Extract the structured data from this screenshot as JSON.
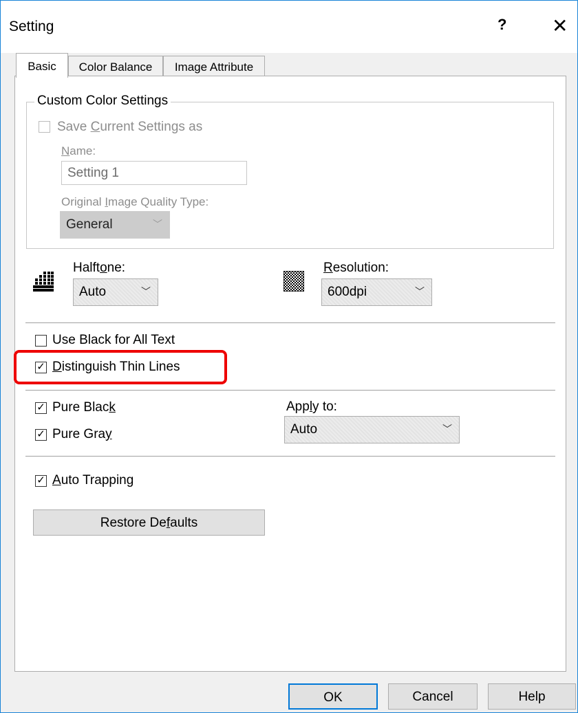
{
  "window": {
    "title": "Setting",
    "help_glyph": "?",
    "close_glyph": "✕"
  },
  "tabs": [
    {
      "label": "Basic",
      "active": true
    },
    {
      "label": "Color Balance",
      "active": false
    },
    {
      "label": "Image Attribute",
      "active": false
    }
  ],
  "custom_color": {
    "group_title": "Custom Color Settings",
    "save_checkbox": {
      "label_pre": "Save ",
      "label_u": "C",
      "label_post": "urrent Settings as",
      "checked": false,
      "enabled": false
    },
    "name_label": {
      "u": "N",
      "post": "ame:"
    },
    "name_value": "Setting 1",
    "quality_label": {
      "pre": "Original ",
      "u": "I",
      "post": "mage Quality Type:"
    },
    "quality_value": "General"
  },
  "halftone": {
    "label_pre": "Halft",
    "label_u": "o",
    "label_post": "ne:",
    "value": "Auto"
  },
  "resolution": {
    "label_u": "R",
    "label_post": "esolution:",
    "value": "600dpi"
  },
  "checkboxes": {
    "use_black_text": {
      "label": "Use Black for All Text",
      "checked": false
    },
    "distinguish_thin_lines": {
      "label_u": "D",
      "label_post": "istinguish Thin Lines",
      "checked": true
    },
    "pure_black": {
      "label_pre": "Pure Blac",
      "label_u": "k",
      "label_post": "",
      "checked": true
    },
    "pure_gray": {
      "label_pre": "Pure Gra",
      "label_u": "y",
      "label_post": "",
      "checked": true
    },
    "auto_trapping": {
      "label_u": "A",
      "label_post": "uto Trapping",
      "checked": true
    }
  },
  "apply_to": {
    "label_pre": "App",
    "label_u": "l",
    "label_post": "y to:",
    "value": "Auto"
  },
  "restore_defaults": {
    "pre": "Restore De",
    "u": "f",
    "post": "aults"
  },
  "buttons": {
    "ok": "OK",
    "cancel": "Cancel",
    "help": "Help"
  },
  "glyphs": {
    "check": "✓",
    "chevron": "﹀"
  },
  "colors": {
    "accent": "#0078d7",
    "highlight": "#ee0000"
  }
}
